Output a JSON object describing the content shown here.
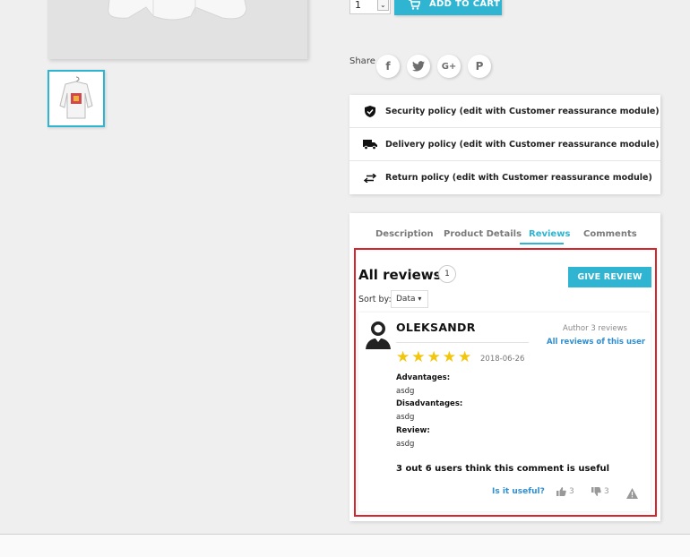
{
  "cart": {
    "qty_value": "1",
    "qty_arrow": "⌄",
    "add_to_cart": "ADD TO CART"
  },
  "share": {
    "label": "Share",
    "buttons": [
      "f",
      "t",
      "G+",
      "P"
    ]
  },
  "reassurance": {
    "items": [
      {
        "icon": "shield-check-icon",
        "label": "Security policy (edit with Customer reassurance module)"
      },
      {
        "icon": "truck-icon",
        "label": "Delivery policy (edit with Customer reassurance module)"
      },
      {
        "icon": "swap-arrows-icon",
        "label": "Return policy (edit with Customer reassurance module)"
      }
    ]
  },
  "tabs": [
    "Description",
    "Product Details",
    "Reviews",
    "Comments"
  ],
  "active_tab": "Reviews",
  "reviews": {
    "title": "All reviews",
    "count": "1",
    "give_review": "GIVE REVIEW",
    "sort_label": "Sort by:",
    "sort_value": "Data",
    "sort_caret": "▾",
    "items": [
      {
        "author": "OLEKSANDR",
        "author_meta": "Author 3 reviews",
        "author_link": "All reviews of this user",
        "rating": 5,
        "date": "2018-06-26",
        "advantages_label": "Advantages:",
        "advantages": "asdg",
        "disadvantages_label": "Disadvantages:",
        "disadvantages": "asdg",
        "review_label": "Review:",
        "review": "asdg",
        "useful_summary": "3 out 6 users think this comment is useful",
        "is_useful": "Is it useful?",
        "upvotes": "3",
        "downvotes": "3"
      }
    ]
  },
  "colors": {
    "accent": "#2fb5d2",
    "highlight": "#d9242b",
    "star": "#f2c60c",
    "link": "#2f8fd2"
  }
}
